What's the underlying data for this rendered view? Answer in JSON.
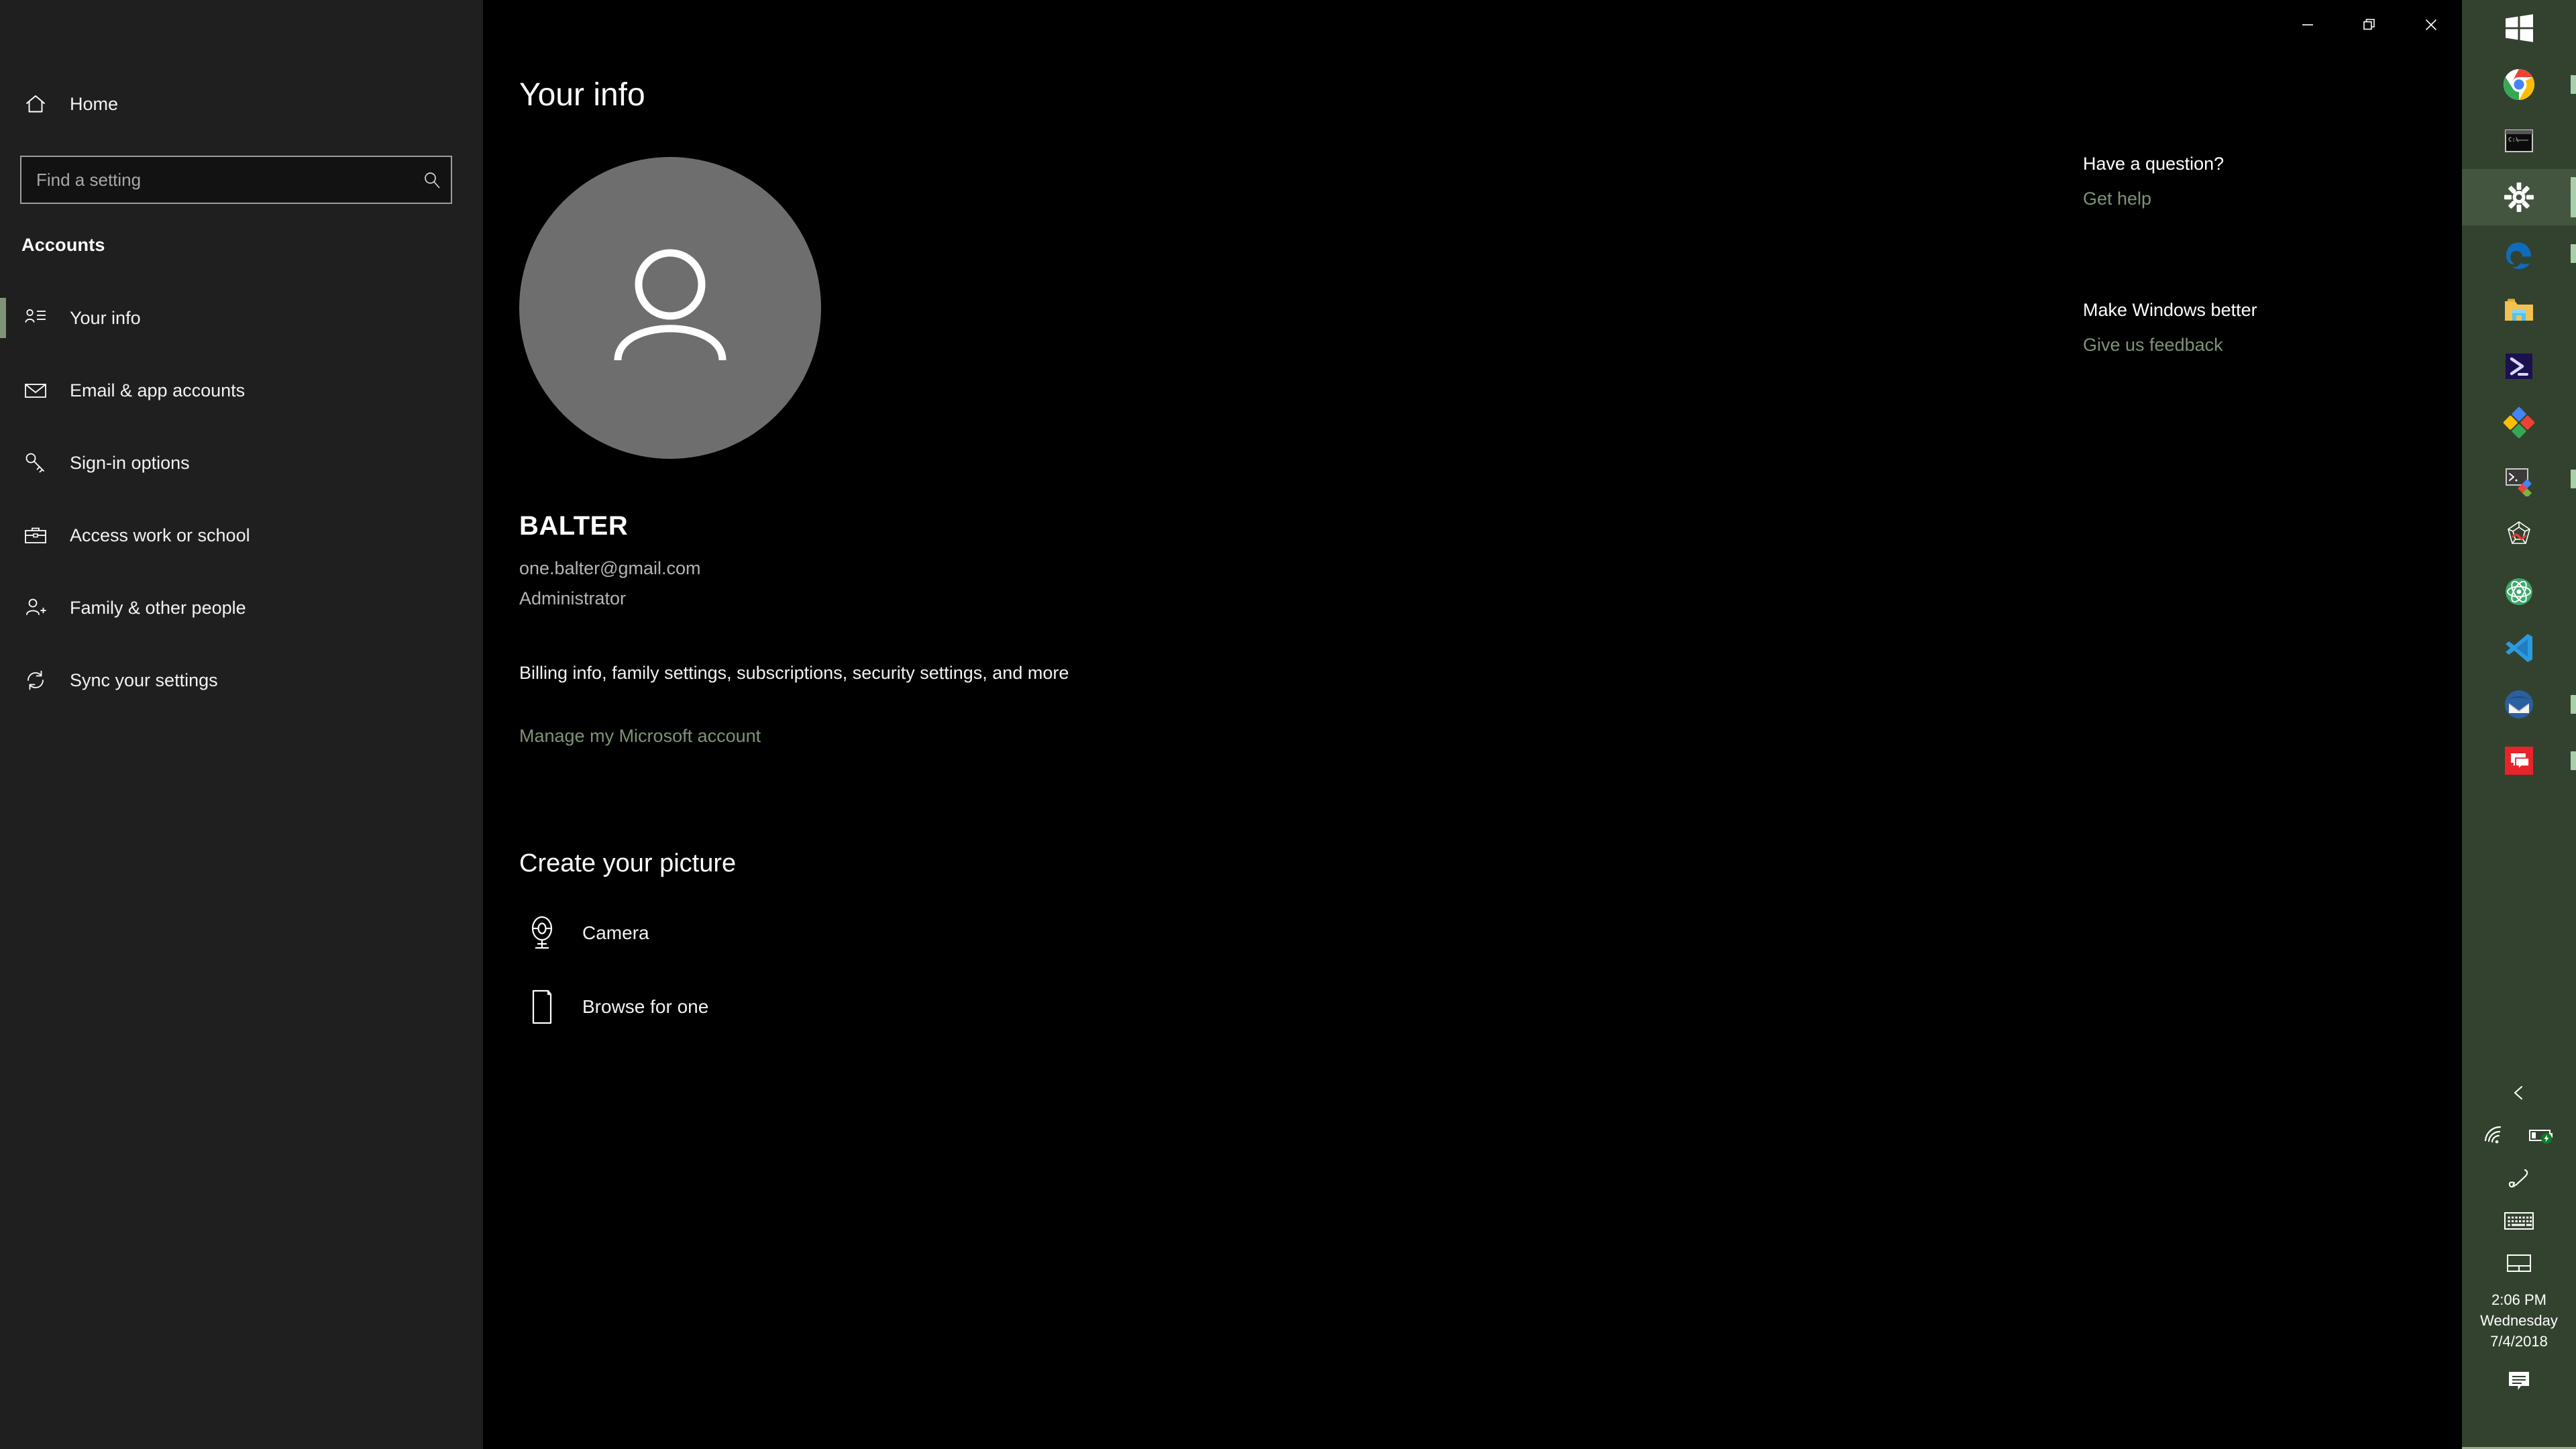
{
  "window": {
    "title": "Settings",
    "controls": [
      {
        "name": "minimize",
        "label": "Minimize"
      },
      {
        "name": "restore",
        "label": "Restore"
      },
      {
        "name": "close",
        "label": "Close"
      }
    ]
  },
  "sidebar": {
    "home_label": "Home",
    "home_icon": "home-icon",
    "search": {
      "placeholder": "Find a setting",
      "value": "",
      "icon": "search-icon"
    },
    "section_title": "Accounts",
    "items": [
      {
        "label": "Your info",
        "icon": "contact-card-icon",
        "selected": true
      },
      {
        "label": "Email & app accounts",
        "icon": "mail-icon",
        "selected": false
      },
      {
        "label": "Sign-in options",
        "icon": "key-icon",
        "selected": false
      },
      {
        "label": "Access work or school",
        "icon": "briefcase-icon",
        "selected": false
      },
      {
        "label": "Family & other people",
        "icon": "add-person-icon",
        "selected": false
      },
      {
        "label": "Sync your settings",
        "icon": "sync-icon",
        "selected": false
      }
    ]
  },
  "main": {
    "page_title": "Your info",
    "avatar_icon": "person-avatar-icon",
    "account": {
      "name": "BALTER",
      "email": "one.balter@gmail.com",
      "role": "Administrator",
      "billing_text": "Billing info, family settings, subscriptions, security settings, and more",
      "manage_link": "Manage my Microsoft account"
    },
    "create_picture": {
      "title": "Create your picture",
      "options": [
        {
          "label": "Camera",
          "icon": "webcam-icon"
        },
        {
          "label": "Browse for one",
          "icon": "browse-file-icon"
        }
      ]
    }
  },
  "help_panel": {
    "blocks": [
      {
        "heading": "Have a question?",
        "link": "Get help",
        "link_icon": "help-link"
      },
      {
        "heading": "Make Windows better",
        "link": "Give us feedback",
        "link_icon": "feedback-link"
      }
    ]
  },
  "taskbar": {
    "items": [
      {
        "name": "start-button",
        "icon": "windows-logo-icon",
        "running": false,
        "active": false
      },
      {
        "name": "google-chrome",
        "icon": "chrome-icon",
        "running": true,
        "active": false
      },
      {
        "name": "command-prompt",
        "icon": "cmd-icon",
        "running": false,
        "active": false
      },
      {
        "name": "settings",
        "icon": "gear-icon",
        "running": true,
        "active": true
      },
      {
        "name": "microsoft-edge",
        "icon": "edge-icon",
        "running": true,
        "active": false
      },
      {
        "name": "file-explorer",
        "icon": "folder-icon",
        "running": false,
        "active": false
      },
      {
        "name": "powershell",
        "icon": "powershell-icon",
        "running": false,
        "active": false
      },
      {
        "name": "office",
        "icon": "office-icon",
        "running": false,
        "active": false
      },
      {
        "name": "cmder-terminal",
        "icon": "terminal-puzzle-icon",
        "running": true,
        "active": false
      },
      {
        "name": "webpack",
        "icon": "spider-web-icon",
        "running": false,
        "active": false
      },
      {
        "name": "atom-editor",
        "icon": "atom-icon",
        "running": false,
        "active": false
      },
      {
        "name": "visual-studio-code",
        "icon": "vscode-icon",
        "running": false,
        "active": false
      },
      {
        "name": "thunderbird",
        "icon": "thunderbird-icon",
        "running": true,
        "active": false
      },
      {
        "name": "chat-app",
        "icon": "chat-bubbles-icon",
        "running": true,
        "active": false
      }
    ],
    "tray": {
      "expand_icon": "chevron-left-icon",
      "wifi_icon": "wifi-icon",
      "battery_icon": "battery-charging-icon",
      "pen_icon": "pen-workspace-icon",
      "keyboard_icon": "touch-keyboard-icon",
      "touchpad_icon": "touchpad-icon",
      "notification_icon": "notification-icon",
      "clock": {
        "time": "2:06 PM",
        "day": "Wednesday",
        "date": "7/4/2018"
      }
    }
  },
  "colors": {
    "accent_link": "#7f9377",
    "taskbar_bg": "#33422f",
    "sidebar_bg": "#1f1f1f",
    "content_bg": "#000000",
    "running_indicator": "#a8ceaa"
  }
}
